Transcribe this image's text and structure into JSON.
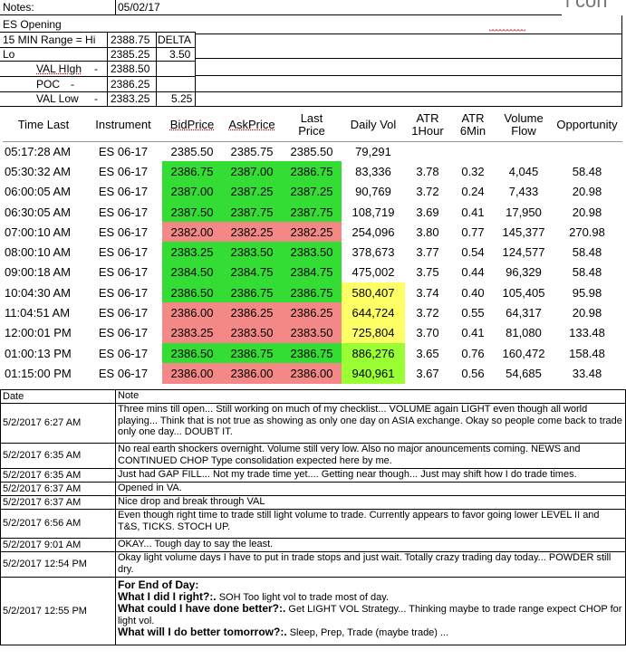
{
  "header": {
    "notes_label": "Notes:",
    "date": "05/02/17",
    "corner_text": "l con",
    "es_opening": "ES Opening",
    "range_label": "15 MIN Range = Hi",
    "hi_value": "2388.75",
    "delta_label": "DELTA",
    "lo_label": "Lo",
    "lo_value": "2385.25",
    "delta_value": "3.50",
    "val_high_label": "VAL HIgh",
    "val_high_dash": "-",
    "val_high_value": "2388.50",
    "poc_label": "POC",
    "poc_dash": "-",
    "poc_value": "2386.25",
    "val_low_label": "VAL Low",
    "val_low_dash": "-",
    "val_low_value": "2383.25",
    "val_low_delta": "5.25"
  },
  "table": {
    "headers": {
      "time": "Time Last",
      "instrument": "Instrument",
      "bid": "BidPrice",
      "ask": "AskPrice",
      "last_1": "Last",
      "last_2": "Price",
      "daily_vol": "Daily Vol",
      "atr1_1": "ATR",
      "atr1_2": "1Hour",
      "atr6_1": "ATR",
      "atr6_2": "6Min",
      "vflow_1": "Volume",
      "vflow_2": "Flow",
      "opportunity": "Opportunity"
    },
    "rows": [
      {
        "time": "05:17:28 AM",
        "inst": "ES 06-17",
        "bid": "2385.50",
        "ask": "2385.75",
        "last": "2385.50",
        "vol": "79,291",
        "atr1": "",
        "atr6": "",
        "vflow": "",
        "opp": "",
        "color": "none",
        "volcolor": "none"
      },
      {
        "time": "05:30:32 AM",
        "inst": "ES 06-17",
        "bid": "2386.75",
        "ask": "2387.00",
        "last": "2386.75",
        "vol": "83,336",
        "atr1": "3.78",
        "atr6": "0.32",
        "vflow": "4,045",
        "opp": "58.48",
        "color": "green",
        "volcolor": "none"
      },
      {
        "time": "06:00:05 AM",
        "inst": "ES 06-17",
        "bid": "2387.00",
        "ask": "2387.25",
        "last": "2387.25",
        "vol": "90,769",
        "atr1": "3.72",
        "atr6": "0.24",
        "vflow": "7,433",
        "opp": "20.98",
        "color": "green",
        "volcolor": "none"
      },
      {
        "time": "06:30:05 AM",
        "inst": "ES 06-17",
        "bid": "2387.50",
        "ask": "2387.75",
        "last": "2387.75",
        "vol": "108,719",
        "atr1": "3.69",
        "atr6": "0.41",
        "vflow": "17,950",
        "opp": "20.98",
        "color": "green",
        "volcolor": "none"
      },
      {
        "time": "07:00:10 AM",
        "inst": "ES 06-17",
        "bid": "2382.00",
        "ask": "2382.25",
        "last": "2382.25",
        "vol": "254,096",
        "atr1": "3.80",
        "atr6": "0.77",
        "vflow": "145,377",
        "opp": "270.98",
        "color": "red",
        "volcolor": "none"
      },
      {
        "time": "08:00:10 AM",
        "inst": "ES 06-17",
        "bid": "2383.25",
        "ask": "2383.50",
        "last": "2383.50",
        "vol": "378,673",
        "atr1": "3.77",
        "atr6": "0.54",
        "vflow": "124,577",
        "opp": "58.48",
        "color": "green",
        "volcolor": "none"
      },
      {
        "time": "09:00:18 AM",
        "inst": "ES 06-17",
        "bid": "2384.50",
        "ask": "2384.75",
        "last": "2384.75",
        "vol": "475,002",
        "atr1": "3.75",
        "atr6": "0.44",
        "vflow": "96,329",
        "opp": "58.48",
        "color": "green",
        "volcolor": "none"
      },
      {
        "time": "10:04:30 AM",
        "inst": "ES 06-17",
        "bid": "2386.50",
        "ask": "2386.75",
        "last": "2386.75",
        "vol": "580,407",
        "atr1": "3.74",
        "atr6": "0.40",
        "vflow": "105,405",
        "opp": "95.98",
        "color": "green",
        "volcolor": "yellow"
      },
      {
        "time": "11:04:51 AM",
        "inst": "ES 06-17",
        "bid": "2386.00",
        "ask": "2386.25",
        "last": "2386.25",
        "vol": "644,724",
        "atr1": "3.72",
        "atr6": "0.55",
        "vflow": "64,317",
        "opp": "20.98",
        "color": "red",
        "volcolor": "yellow"
      },
      {
        "time": "12:00:01 PM",
        "inst": "ES 06-17",
        "bid": "2383.25",
        "ask": "2383.50",
        "last": "2383.50",
        "vol": "725,804",
        "atr1": "3.70",
        "atr6": "0.41",
        "vflow": "81,080",
        "opp": "133.48",
        "color": "red",
        "volcolor": "yellow"
      },
      {
        "time": "01:00:13 PM",
        "inst": "ES 06-17",
        "bid": "2386.50",
        "ask": "2386.75",
        "last": "2386.75",
        "vol": "886,276",
        "atr1": "3.65",
        "atr6": "0.76",
        "vflow": "160,472",
        "opp": "158.48",
        "color": "green",
        "volcolor": "vol-green"
      },
      {
        "time": "01:15:00 PM",
        "inst": "ES 06-17",
        "bid": "2386.00",
        "ask": "2386.00",
        "last": "2386.00",
        "vol": "940,961",
        "atr1": "3.67",
        "atr6": "0.56",
        "vflow": "54,685",
        "opp": "33.48",
        "color": "red",
        "volcolor": "vol-green"
      }
    ]
  },
  "notes": {
    "date_header": "Date",
    "note_header": "Note",
    "entries": [
      {
        "date": "5/2/2017 6:27 AM",
        "text": "Three mins till open... Still working on much of my checklist... VOLUME again LIGHT even though all world playing... Think that is not true as showing as only one day on ASIA exchange.  Okay so people come back to trade only one day... DOUBT IT."
      },
      {
        "date": "5/2/2017 6:35 AM",
        "text": "No real earth shockers overnight.  Volume still very low.  Also no major anouncements coming.  NEWS and CONTINUED CHOP  Type consolidation expected here by me."
      },
      {
        "date": "5/2/2017 6:35 AM",
        "text": "Just had GAP FILL... Not my trade time yet.... Getting near though... Just may shift how I do trade times."
      },
      {
        "date": "5/2/2017 6:37 AM",
        "text": "Opened in VA."
      },
      {
        "date": "5/2/2017 6:37 AM",
        "text": "Nice drop and break through VAL"
      },
      {
        "date": "5/2/2017 6:56 AM",
        "text": "Even though right time to trade still light volume to trade.  Currently appears to favor going lower LEVEL II and T&S, TICKS.  STOCH UP."
      },
      {
        "date": "5/2/2017 9:01 AM",
        "text": "OKAY... Tough day to say the least."
      },
      {
        "date": "5/2/2017 12:54 PM",
        "text": "Okay light volume days I have to put in trade stops and just wait.  Totally crazy trading day today... POWDER still dry."
      }
    ],
    "final": {
      "date": "5/2/2017 12:55 PM",
      "title": "For End of Day:",
      "q1": "What I did I right?:.",
      "a1": " SOH  Too light vol to trade most of day.",
      "q2": "What could I have done better?:.",
      "a2": "  Get LIGHT VOL Strategy... Thinking maybe to trade range expect CHOP for light vol.",
      "q3": "What will I do better tomorrow?:.",
      "a3": "  Sleep, Prep, Trade (maybe trade) ..."
    }
  }
}
